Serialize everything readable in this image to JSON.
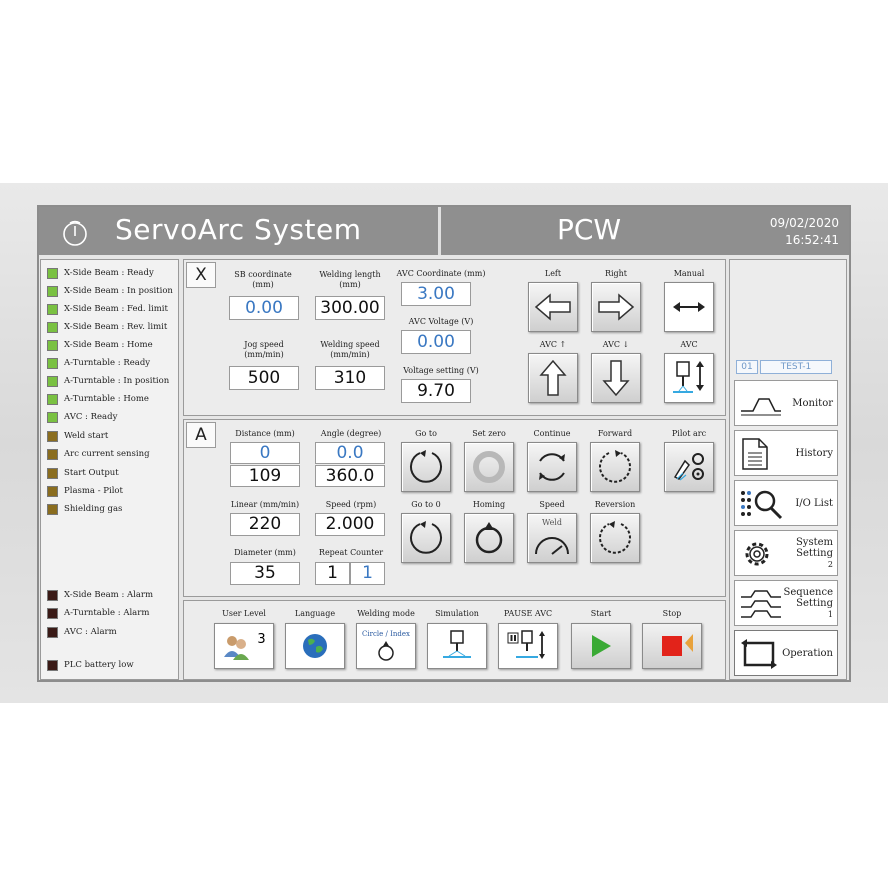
{
  "header": {
    "app_title": "ServoArc  System",
    "mode_title": "PCW",
    "date": "09/02/2020",
    "time": "16:52:41"
  },
  "status_lamps": [
    {
      "label": "X-Side Beam : Ready",
      "color": "#7ac142"
    },
    {
      "label": "X-Side Beam : In position",
      "color": "#7ac142"
    },
    {
      "label": "X-Side Beam : Fed. limit",
      "color": "#7ac142"
    },
    {
      "label": "X-Side Beam : Rev. limit",
      "color": "#7ac142"
    },
    {
      "label": "X-Side Beam : Home",
      "color": "#7ac142"
    },
    {
      "label": "A-Turntable : Ready",
      "color": "#7ac142"
    },
    {
      "label": "A-Turntable : In position",
      "color": "#7ac142"
    },
    {
      "label": "A-Turntable : Home",
      "color": "#7ac142"
    },
    {
      "label": "AVC : Ready",
      "color": "#7ac142"
    },
    {
      "label": "Weld start",
      "color": "#8a6d1f"
    },
    {
      "label": "Arc current sensing",
      "color": "#8a6d1f"
    },
    {
      "label": "Start Output",
      "color": "#8a6d1f"
    },
    {
      "label": "Plasma - Pilot",
      "color": "#8a6d1f"
    },
    {
      "label": "Shielding gas",
      "color": "#8a6d1f"
    }
  ],
  "alarm_lamps": [
    {
      "label": "X-Side Beam : Alarm",
      "color": "#3a1a16"
    },
    {
      "label": "A-Turntable : Alarm",
      "color": "#3a1a16"
    },
    {
      "label": "AVC : Alarm",
      "color": "#3a1a16"
    },
    {
      "label": "PLC battery low",
      "color": "#3a1a16"
    }
  ],
  "x_panel": {
    "tag": "X",
    "sb_coord_label_1": "SB coordinate",
    "sb_coord_label_2": "(mm)",
    "sb_coord_value": "0.00",
    "weld_len_label_1": "Welding length",
    "weld_len_label_2": "(mm)",
    "weld_len_value": "300.00",
    "avc_coord_label": "AVC Coordinate (mm)",
    "avc_coord_value": "3.00",
    "avc_voltage_label": "AVC Voltage (V)",
    "avc_voltage_value": "0.00",
    "jog_label_1": "Jog speed",
    "jog_label_2": "(mm/min)",
    "jog_value": "500",
    "weld_speed_label_1": "Welding speed",
    "weld_speed_label_2": "(mm/min)",
    "weld_speed_value": "310",
    "volt_setting_label": "Voltage setting (V)",
    "volt_setting_value": "9.70",
    "left_label": "Left",
    "right_label": "Right",
    "manual_label": "Manual",
    "avc_up_label": "AVC ↑",
    "avc_down_label": "AVC ↓",
    "avc_label": "AVC"
  },
  "a_panel": {
    "tag": "A",
    "distance_label": "Distance (mm)",
    "distance_value_1": "0",
    "distance_value_2": "109",
    "angle_label": "Angle (degree)",
    "angle_value_1": "0.0",
    "angle_value_2": "360.0",
    "linear_label": "Linear (mm/min)",
    "linear_value": "220",
    "speed_label": "Speed (rpm)",
    "speed_value": "2.000",
    "diameter_label": "Diameter (mm)",
    "diameter_value": "35",
    "repeat_label": "Repeat Counter",
    "repeat_value_1": "1",
    "repeat_value_2": "1",
    "goto_label": "Go to",
    "setzero_label": "Set zero",
    "continue_label": "Continue",
    "forward_label": "Forward",
    "pilotarc_label": "Pilot arc",
    "goto0_label": "Go to 0",
    "homing_label": "Homing",
    "speed_btn_label": "Speed",
    "speed_btn_inner": "Weld",
    "reversion_label": "Reversion"
  },
  "bottom_bar": {
    "user_level_label": "User Level",
    "user_level_value": "3",
    "language_label": "Language",
    "welding_mode_label": "Welding mode",
    "welding_mode_value": "Circle / Index",
    "simulation_label": "Simulation",
    "pause_avc_label": "PAUSE AVC",
    "start_label": "Start",
    "stop_label": "Stop"
  },
  "right_nav": {
    "job_number": "01",
    "job_name": "TEST-1",
    "items": [
      {
        "label": "Monitor"
      },
      {
        "label": "History"
      },
      {
        "label": "I/O List"
      },
      {
        "label": "System Setting",
        "badge": "2"
      },
      {
        "label": "Sequence Setting",
        "badge": "1"
      },
      {
        "label": "Operation"
      }
    ]
  },
  "colors": {
    "header_bg": "#8f8f8f",
    "start_green": "#3aaa35",
    "stop_red": "#e2231a",
    "active_marker": "#e8a23c",
    "value_blue": "#3a78c2"
  }
}
